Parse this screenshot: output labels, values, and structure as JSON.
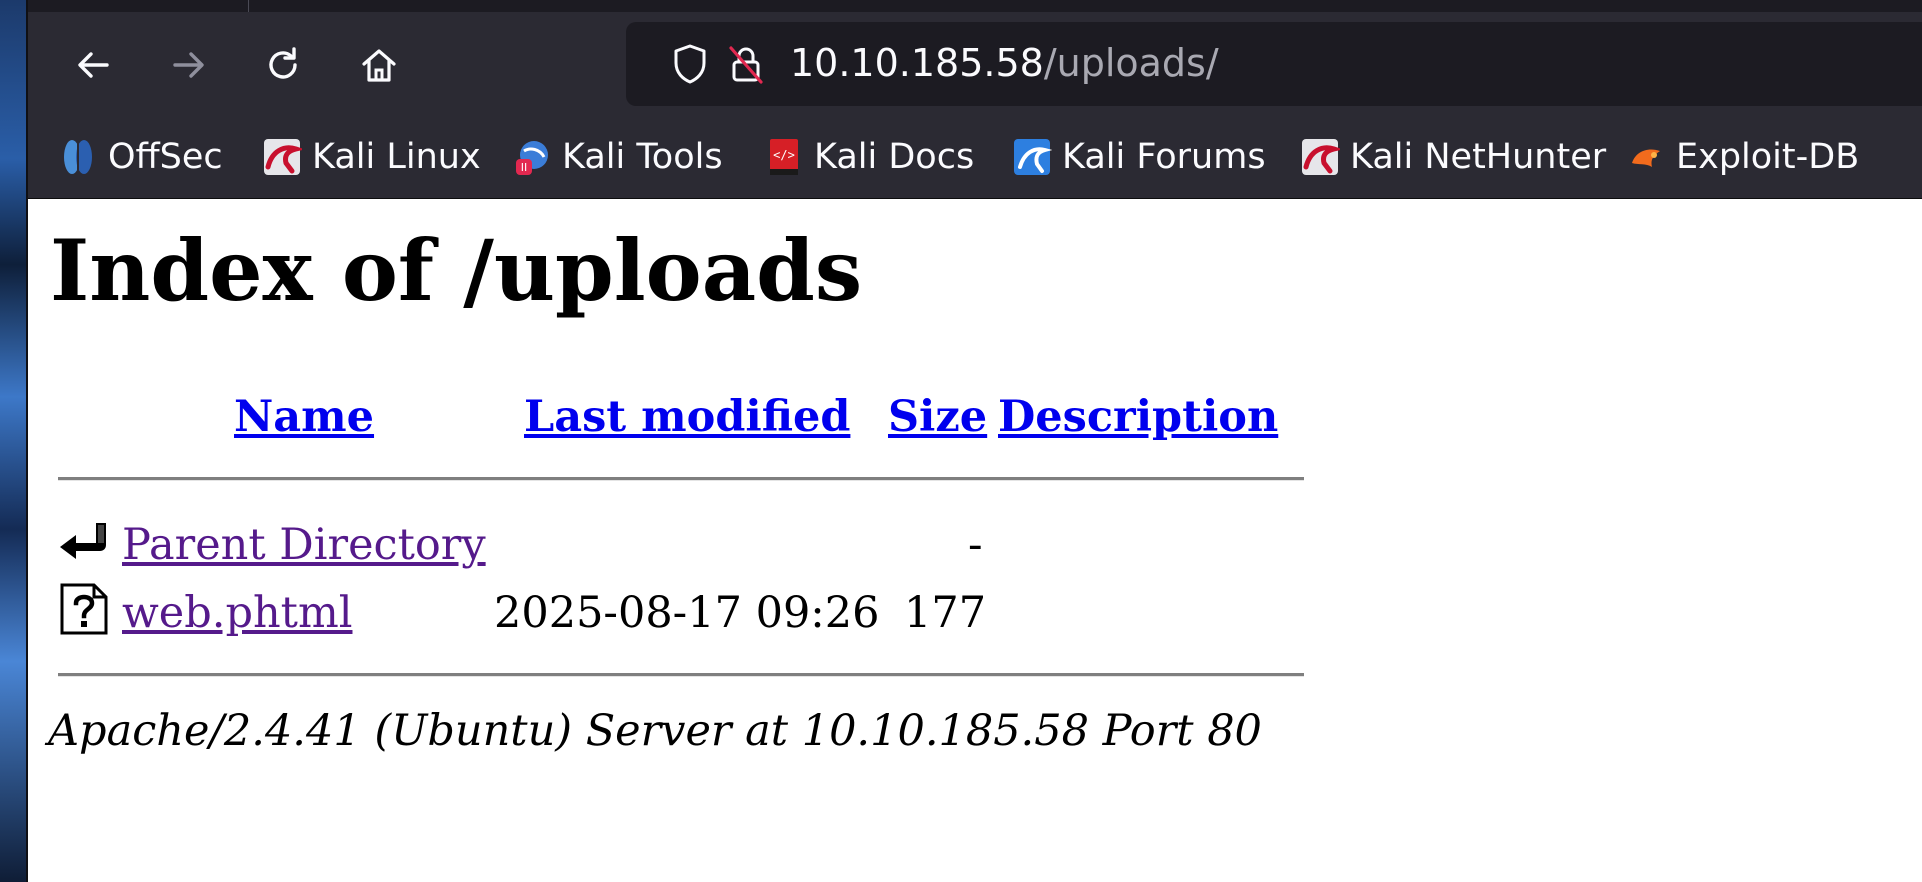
{
  "browser": {
    "url_host": "10.10.185.58",
    "url_path": "/uploads/",
    "nav": {
      "back_icon": "arrow-left",
      "forward_icon": "arrow-right",
      "reload_icon": "reload",
      "home_icon": "home"
    },
    "bookmarks": [
      {
        "label": "OffSec",
        "icon": "offsec-logo"
      },
      {
        "label": "Kali Linux",
        "icon": "kali-dragon"
      },
      {
        "label": "Kali Tools",
        "icon": "kali-tools"
      },
      {
        "label": "Kali Docs",
        "icon": "kali-docs"
      },
      {
        "label": "Kali Forums",
        "icon": "kali-forums"
      },
      {
        "label": "Kali NetHunter",
        "icon": "kali-dragon"
      },
      {
        "label": "Exploit-DB",
        "icon": "exploit-db"
      }
    ]
  },
  "page": {
    "title": "Index of /uploads",
    "columns": {
      "name": "Name",
      "last_modified": "Last modified",
      "size": "Size",
      "description": "Description"
    },
    "rows": [
      {
        "name": "Parent Directory",
        "last_modified": "",
        "size": "-",
        "icon": "back-folder-icon"
      },
      {
        "name": "web.phtml",
        "last_modified": "2025-08-17 09:26",
        "size": "177",
        "icon": "unknown-file-icon"
      }
    ],
    "footer": "Apache/2.4.41 (Ubuntu) Server at 10.10.185.58 Port 80"
  },
  "colors": {
    "link": "#0000ee",
    "visited": "#551a8b",
    "toolbar": "#2b2a33",
    "urlbar": "#1c1b22"
  }
}
